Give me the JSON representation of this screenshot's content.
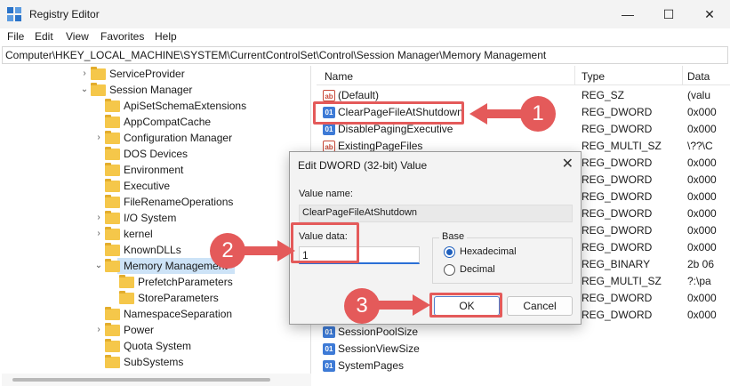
{
  "window": {
    "title": "Registry Editor",
    "minimize_glyph": "—",
    "maximize_glyph": "☐",
    "close_glyph": "✕"
  },
  "menu": [
    "File",
    "Edit",
    "View",
    "Favorites",
    "Help"
  ],
  "address": "Computer\\HKEY_LOCAL_MACHINE\\SYSTEM\\CurrentControlSet\\Control\\Session Manager\\Memory Management",
  "tree": {
    "items": [
      {
        "label": "ServiceProvider",
        "chevron": "›"
      },
      {
        "label": "Session Manager",
        "chevron": "⌄"
      },
      {
        "label": "ApiSetSchemaExtensions",
        "chevron": ""
      },
      {
        "label": "AppCompatCache",
        "chevron": ""
      },
      {
        "label": "Configuration Manager",
        "chevron": "›"
      },
      {
        "label": "DOS Devices",
        "chevron": ""
      },
      {
        "label": "Environment",
        "chevron": ""
      },
      {
        "label": "Executive",
        "chevron": ""
      },
      {
        "label": "FileRenameOperations",
        "chevron": ""
      },
      {
        "label": "I/O System",
        "chevron": "›"
      },
      {
        "label": "kernel",
        "chevron": "›"
      },
      {
        "label": "KnownDLLs",
        "chevron": ""
      },
      {
        "label": "Memory Management",
        "chevron": "⌄"
      },
      {
        "label": "PrefetchParameters",
        "chevron": ""
      },
      {
        "label": "StoreParameters",
        "chevron": ""
      },
      {
        "label": "NamespaceSeparation",
        "chevron": ""
      },
      {
        "label": "Power",
        "chevron": "›"
      },
      {
        "label": "Quota System",
        "chevron": ""
      },
      {
        "label": "SubSystems",
        "chevron": ""
      }
    ]
  },
  "list": {
    "columns": [
      "Name",
      "Type",
      "Data"
    ],
    "rows": [
      {
        "name": "(Default)",
        "type": "REG_SZ",
        "data": "(valu",
        "icon": "ab"
      },
      {
        "name": "ClearPageFileAtShutdown",
        "type": "REG_DWORD",
        "data": "0x000",
        "icon": "bin"
      },
      {
        "name": "DisablePagingExecutive",
        "type": "REG_DWORD",
        "data": "0x000",
        "icon": "bin"
      },
      {
        "name": "ExistingPageFiles",
        "type": "REG_MULTI_SZ",
        "data": "\\??\\C",
        "icon": "ab"
      },
      {
        "name": "",
        "type": "REG_DWORD",
        "data": "0x000",
        "icon": ""
      },
      {
        "name": "",
        "type": "REG_DWORD",
        "data": "0x000",
        "icon": ""
      },
      {
        "name": "",
        "type": "REG_DWORD",
        "data": "0x000",
        "icon": ""
      },
      {
        "name": "",
        "type": "REG_DWORD",
        "data": "0x000",
        "icon": ""
      },
      {
        "name": "",
        "type": "REG_DWORD",
        "data": "0x000",
        "icon": ""
      },
      {
        "name": "",
        "type": "REG_DWORD",
        "data": "0x000",
        "icon": ""
      },
      {
        "name": "",
        "type": "REG_BINARY",
        "data": "2b 06",
        "icon": ""
      },
      {
        "name": "",
        "type": "REG_MULTI_SZ",
        "data": "?:\\pa",
        "icon": ""
      },
      {
        "name": "",
        "type": "REG_DWORD",
        "data": "0x000",
        "icon": ""
      },
      {
        "name": "",
        "type": "REG_DWORD",
        "data": "0x000",
        "icon": ""
      },
      {
        "name": "SessionPoolSize",
        "type": "",
        "data": "",
        "icon": "bin"
      },
      {
        "name": "SessionViewSize",
        "type": "",
        "data": "",
        "icon": "bin"
      },
      {
        "name": "SystemPages",
        "type": "",
        "data": "",
        "icon": "bin"
      }
    ]
  },
  "dialog": {
    "title": "Edit DWORD (32-bit) Value",
    "value_name_label": "Value name:",
    "value_name": "ClearPageFileAtShutdown",
    "value_data_label": "Value data:",
    "value_data": "1",
    "base_label": "Base",
    "radio_hex": "Hexadecimal",
    "radio_dec": "Decimal",
    "selected_base": "Hexadecimal",
    "ok_label": "OK",
    "cancel_label": "Cancel",
    "close_glyph": "✕"
  },
  "callouts": [
    "1",
    "2",
    "3"
  ],
  "colors": {
    "highlight": "#e45a5a",
    "folder": "#f5c74a",
    "accent": "#1f5fbd"
  }
}
